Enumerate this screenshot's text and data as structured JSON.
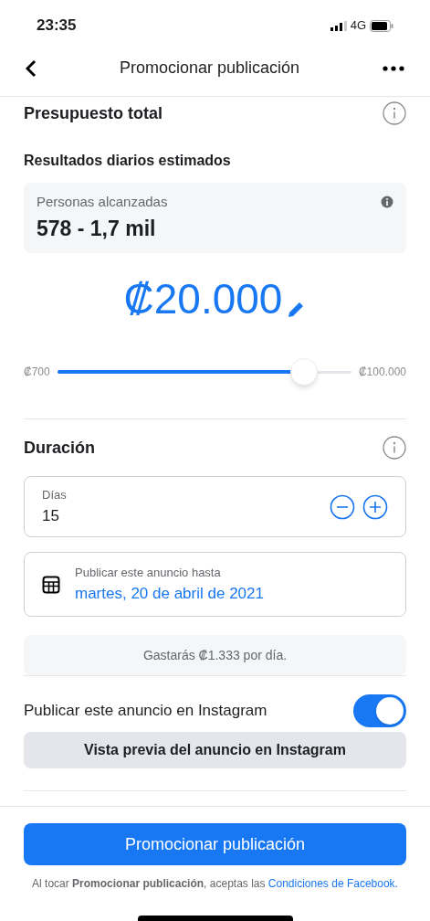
{
  "status_bar": {
    "time": "23:35",
    "network": "4G"
  },
  "header": {
    "title": "Promocionar publicación"
  },
  "budget": {
    "title": "Presupuesto total",
    "results_title": "Resultados diarios estimados",
    "reach_label": "Personas alcanzadas",
    "reach_value": "578 - 1,7 mil",
    "amount": "₡20.000",
    "slider": {
      "min_label": "₡700",
      "max_label": "₡100.000",
      "level": 0.84
    }
  },
  "duration": {
    "title": "Duración",
    "days_label": "Días",
    "days_value": "15",
    "end_label": "Publicar este anuncio hasta",
    "end_value": "martes, 20 de abril de 2021",
    "spend_note": "Gastarás ₡1.333 por día."
  },
  "instagram": {
    "label": "Publicar este anuncio en Instagram",
    "on": true,
    "preview_button": "Vista previa del anuncio en Instagram"
  },
  "footer": {
    "button": "Promocionar publicación",
    "terms": "Al tocar **Promocionar publicación**, aceptas las",
    "terms_link": "Condiciones de Facebook."
  }
}
